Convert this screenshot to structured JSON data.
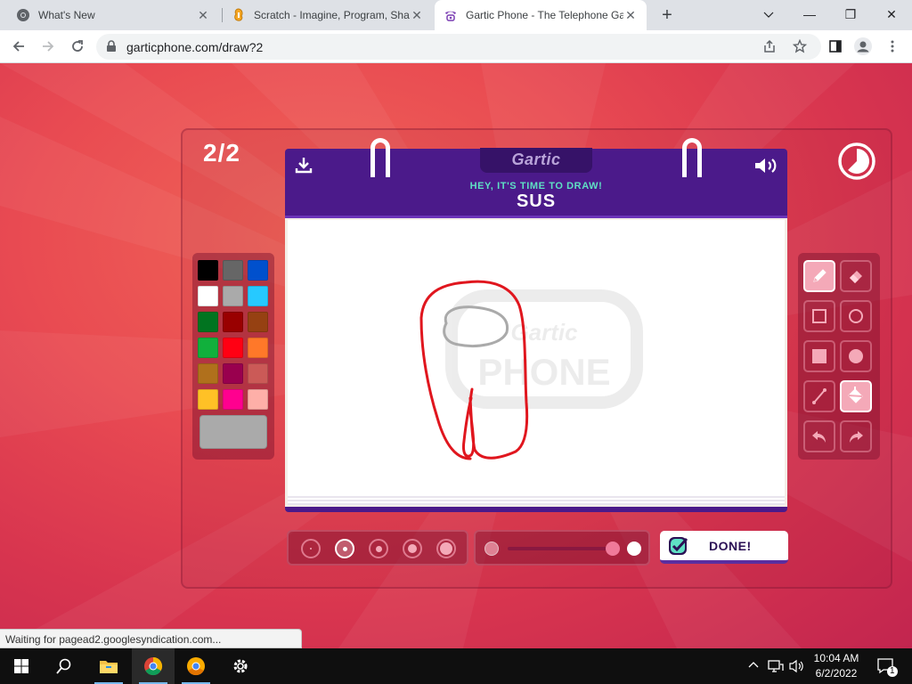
{
  "browser": {
    "tabs": [
      {
        "title": "What's New",
        "active": false
      },
      {
        "title": "Scratch - Imagine, Program, Shar",
        "active": false
      },
      {
        "title": "Gartic Phone - The Telephone Ga",
        "active": true
      }
    ],
    "new_tab": "+",
    "window_controls": {
      "minimize": "—",
      "maximize": "❐",
      "close": "✕"
    },
    "url": "garticphone.com/draw?2"
  },
  "game": {
    "round": "2/2",
    "logo": "Gartic",
    "subtitle": "HEY, IT'S TIME TO DRAW!",
    "word": "SUS",
    "done_label": "DONE!",
    "watermark": "Gartic PHONE",
    "palette": [
      "#000000",
      "#666666",
      "#0050cd",
      "#ffffff",
      "#aaaaaa",
      "#26c9ff",
      "#017420",
      "#990000",
      "#964112",
      "#11b03c",
      "#ff0013",
      "#ff7829",
      "#b0701c",
      "#99004e",
      "#cb5a57",
      "#ffc126",
      "#ff008f",
      "#feafa8"
    ],
    "selected_color": "#aaaaaa",
    "tools": [
      "pencil",
      "eraser",
      "rectangle-outline",
      "ellipse-outline",
      "rectangle-filled",
      "ellipse-filled",
      "line",
      "fill",
      "undo",
      "redo"
    ],
    "selected_tool": "fill",
    "brush_sizes": [
      1,
      2,
      3,
      4,
      5
    ],
    "selected_brush_size": 2,
    "opacity": 1.0
  },
  "status_bar": "Waiting for pagead2.googlesyndication.com...",
  "taskbar": {
    "apps": [
      "start",
      "search",
      "file-explorer",
      "chrome",
      "chrome-canary",
      "settings"
    ],
    "time": "10:04 AM",
    "date": "6/2/2022",
    "notifications": "1"
  }
}
